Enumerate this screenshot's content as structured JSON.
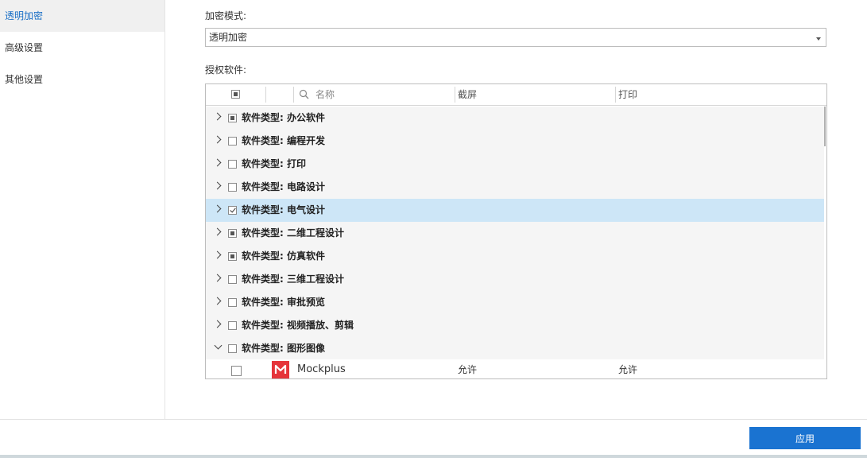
{
  "sidebar": {
    "items": [
      {
        "label": "透明加密",
        "active": true
      },
      {
        "label": "高级设置",
        "active": false
      },
      {
        "label": "其他设置",
        "active": false
      }
    ]
  },
  "mode": {
    "label": "加密模式:",
    "selected": "透明加密"
  },
  "software": {
    "label": "授权软件:",
    "columns": {
      "name_placeholder": "名称",
      "screenshot": "截屏",
      "print": "打印"
    },
    "categories": [
      {
        "label": "软件类型: 办公软件",
        "state": "partial",
        "expanded": false,
        "selected": false
      },
      {
        "label": "软件类型: 编程开发",
        "state": "unchecked",
        "expanded": false,
        "selected": false
      },
      {
        "label": "软件类型: 打印",
        "state": "unchecked",
        "expanded": false,
        "selected": false
      },
      {
        "label": "软件类型: 电路设计",
        "state": "unchecked",
        "expanded": false,
        "selected": false
      },
      {
        "label": "软件类型: 电气设计",
        "state": "checked",
        "expanded": false,
        "selected": true
      },
      {
        "label": "软件类型: 二维工程设计",
        "state": "partial",
        "expanded": false,
        "selected": false
      },
      {
        "label": "软件类型: 仿真软件",
        "state": "partial",
        "expanded": false,
        "selected": false
      },
      {
        "label": "软件类型: 三维工程设计",
        "state": "unchecked",
        "expanded": false,
        "selected": false
      },
      {
        "label": "软件类型: 审批预览",
        "state": "unchecked",
        "expanded": false,
        "selected": false
      },
      {
        "label": "软件类型: 视频播放、剪辑",
        "state": "unchecked",
        "expanded": false,
        "selected": false
      },
      {
        "label": "软件类型: 图形图像",
        "state": "unchecked",
        "expanded": true,
        "selected": false
      }
    ],
    "child": {
      "name": "Mockplus",
      "screenshot": "允许",
      "print": "允许",
      "logo_color": "#e5343a"
    }
  },
  "footer": {
    "apply_label": "应用"
  },
  "colors": {
    "accent": "#1a73d1",
    "selection": "#cde6f7"
  }
}
